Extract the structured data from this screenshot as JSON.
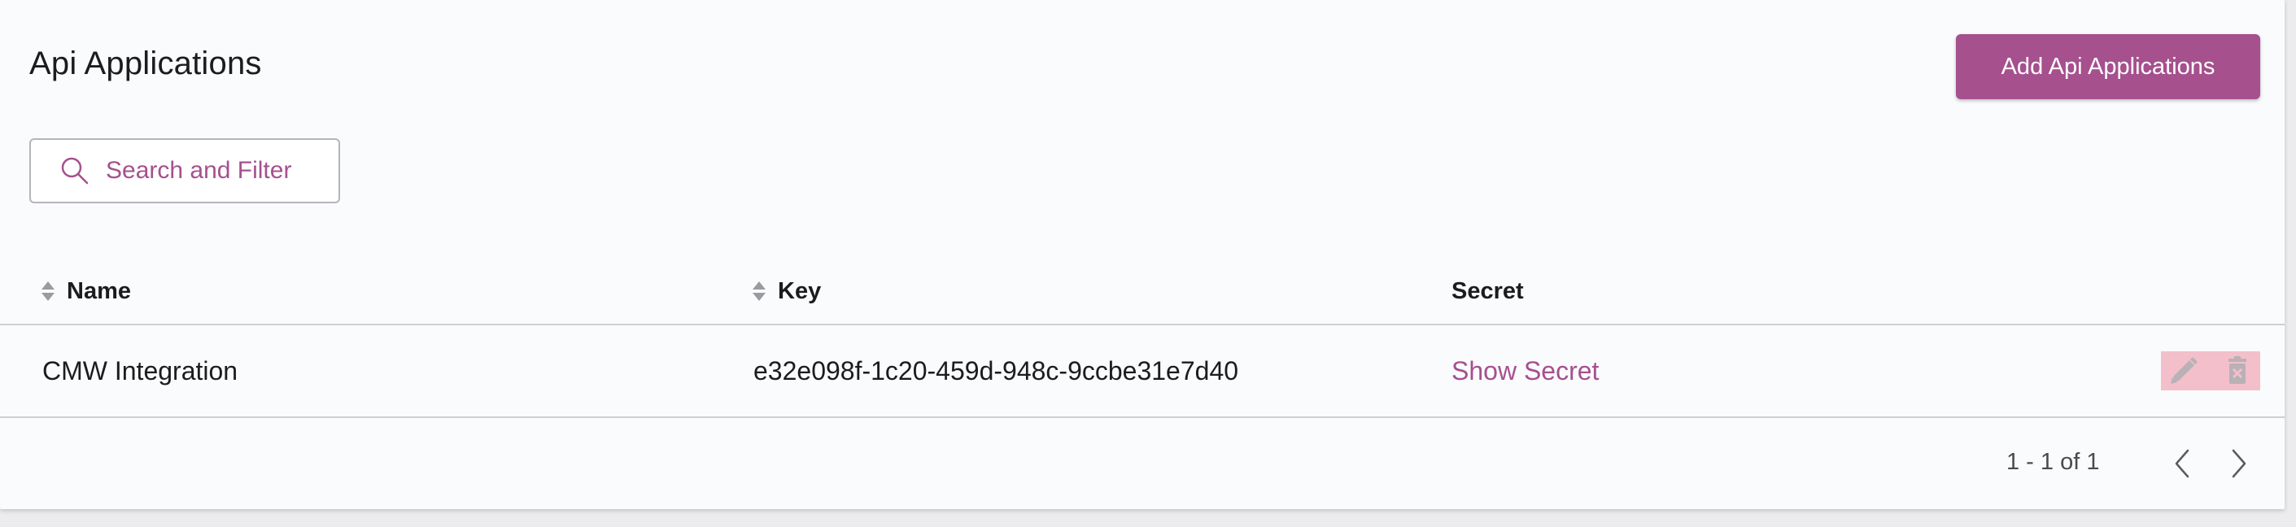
{
  "header": {
    "title": "Api Applications",
    "add_button_label": "Add Api Applications"
  },
  "search": {
    "placeholder": "Search and Filter",
    "value": ""
  },
  "table": {
    "columns": [
      {
        "label": "Name",
        "sortable": true
      },
      {
        "label": "Key",
        "sortable": true
      },
      {
        "label": "Secret",
        "sortable": false
      }
    ],
    "rows": [
      {
        "name": "CMW Integration",
        "key": "e32e098f-1c20-459d-948c-9ccbe31e7d40",
        "secret_link": "Show Secret"
      }
    ],
    "row_action_icons": [
      "pencil-icon",
      "trash-icon"
    ]
  },
  "pagination": {
    "range_text": "1 - 1 of 1"
  },
  "colors": {
    "accent": "#a6508e",
    "action_highlight": "#f3bfcb",
    "background": "#fafbfd"
  }
}
